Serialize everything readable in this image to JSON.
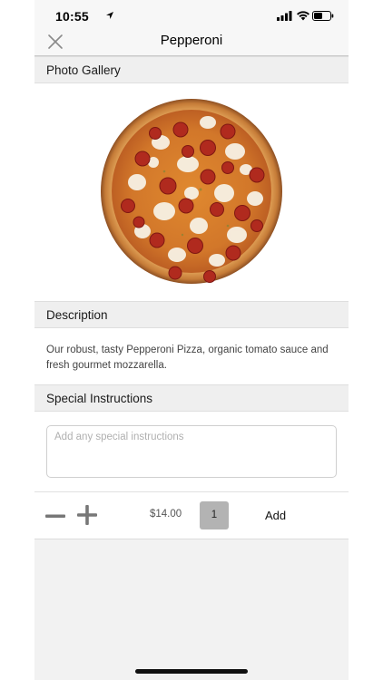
{
  "status_bar": {
    "time": "10:55"
  },
  "nav": {
    "title": "Pepperoni"
  },
  "sections": {
    "gallery": "Photo Gallery",
    "description": "Description",
    "instructions": "Special Instructions"
  },
  "description": {
    "text": "Our robust, tasty Pepperoni Pizza, organic tomato sauce and fresh gourmet mozzarella."
  },
  "instructions": {
    "placeholder": "Add any special instructions",
    "value": ""
  },
  "order": {
    "price": "$14.00",
    "quantity": "1",
    "add_label": "Add"
  },
  "colors": {
    "qty_box": "#b3b3b3",
    "section_bg": "#efefef",
    "background": "#f2f2f2"
  },
  "icons": {
    "close": "close-icon",
    "minus": "minus-icon",
    "plus": "plus-icon",
    "location": "location-arrow-icon",
    "signal": "cellular-signal-icon",
    "wifi": "wifi-icon",
    "battery": "battery-icon"
  }
}
